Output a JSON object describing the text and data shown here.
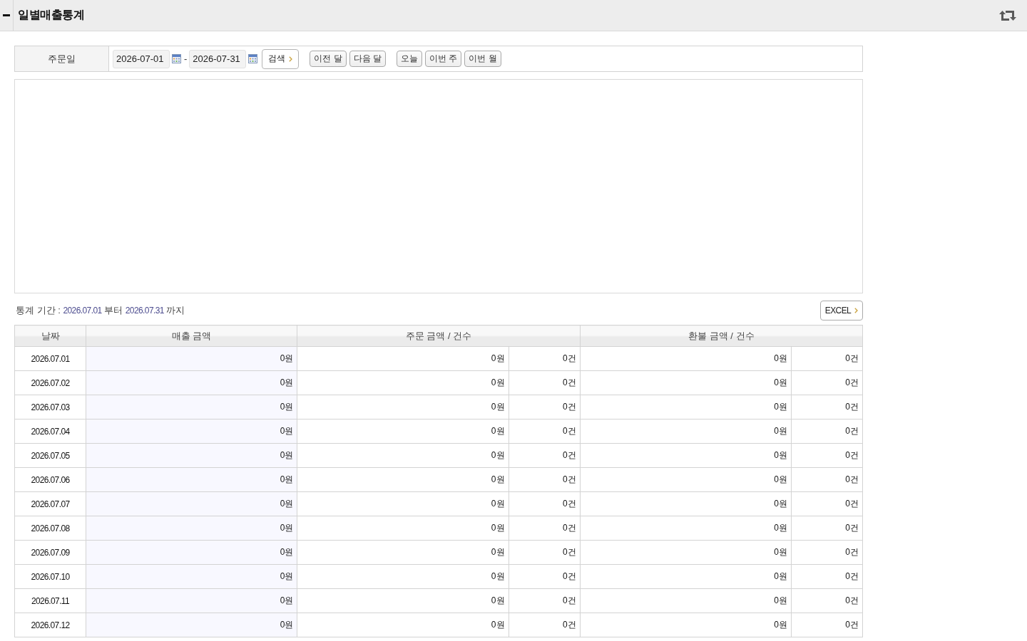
{
  "header": {
    "title": "일별매출통계",
    "expanded": true
  },
  "search": {
    "label": "주문일",
    "start_date": "2026-07-01",
    "separator": "-",
    "end_date": "2026-07-31",
    "search_button": "검색",
    "month_buttons": [
      "이전 달",
      "다음 달"
    ],
    "preset_buttons": [
      "오늘",
      "이번 주",
      "이번 월"
    ]
  },
  "stats_period": {
    "label": "통계 기간 :",
    "start": "2026.07.01",
    "from_word": "부터",
    "end": "2026.07.31",
    "until_word": "까지"
  },
  "excel_button": "EXCEL",
  "table": {
    "columns": [
      "날짜",
      "매출 금액",
      "주문 금액 / 건수",
      "환불 금액 / 건수"
    ],
    "rows": [
      {
        "date": "2026.07.01",
        "sales": "0원",
        "order_amount": "0원",
        "order_count": "0건",
        "refund_amount": "0원",
        "refund_count": "0건"
      },
      {
        "date": "2026.07.02",
        "sales": "0원",
        "order_amount": "0원",
        "order_count": "0건",
        "refund_amount": "0원",
        "refund_count": "0건"
      },
      {
        "date": "2026.07.03",
        "sales": "0원",
        "order_amount": "0원",
        "order_count": "0건",
        "refund_amount": "0원",
        "refund_count": "0건"
      },
      {
        "date": "2026.07.04",
        "sales": "0원",
        "order_amount": "0원",
        "order_count": "0건",
        "refund_amount": "0원",
        "refund_count": "0건"
      },
      {
        "date": "2026.07.05",
        "sales": "0원",
        "order_amount": "0원",
        "order_count": "0건",
        "refund_amount": "0원",
        "refund_count": "0건"
      },
      {
        "date": "2026.07.06",
        "sales": "0원",
        "order_amount": "0원",
        "order_count": "0건",
        "refund_amount": "0원",
        "refund_count": "0건"
      },
      {
        "date": "2026.07.07",
        "sales": "0원",
        "order_amount": "0원",
        "order_count": "0건",
        "refund_amount": "0원",
        "refund_count": "0건"
      },
      {
        "date": "2026.07.08",
        "sales": "0원",
        "order_amount": "0원",
        "order_count": "0건",
        "refund_amount": "0원",
        "refund_count": "0건"
      },
      {
        "date": "2026.07.09",
        "sales": "0원",
        "order_amount": "0원",
        "order_count": "0건",
        "refund_amount": "0원",
        "refund_count": "0건"
      },
      {
        "date": "2026.07.10",
        "sales": "0원",
        "order_amount": "0원",
        "order_count": "0건",
        "refund_amount": "0원",
        "refund_count": "0건"
      },
      {
        "date": "2026.07.11",
        "sales": "0원",
        "order_amount": "0원",
        "order_count": "0건",
        "refund_amount": "0원",
        "refund_count": "0건"
      },
      {
        "date": "2026.07.12",
        "sales": "0원",
        "order_amount": "0원",
        "order_count": "0건",
        "refund_amount": "0원",
        "refund_count": "0건"
      }
    ]
  }
}
